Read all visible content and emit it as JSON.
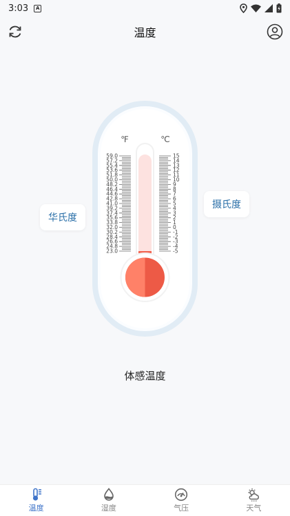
{
  "status_bar": {
    "time": "3:03",
    "notification_icon_letter": "A"
  },
  "header": {
    "title": "温度",
    "left_icon": "refresh-icon",
    "right_icon": "profile-icon"
  },
  "thermometer": {
    "fahrenheit_unit": "℉",
    "celsius_unit": "℃",
    "fahrenheit_scale": [
      "59.0",
      "57.2",
      "55.4",
      "53.6",
      "51.8",
      "50.0",
      "48.2",
      "46.4",
      "44.6",
      "42.8",
      "41.0",
      "39.2",
      "37.4",
      "35.6",
      "33.8",
      "32.0",
      "30.2",
      "28.4",
      "26.6",
      "24.8",
      "23.0"
    ],
    "celsius_scale": [
      "15",
      "14",
      "13",
      "12",
      "11",
      "10",
      "9",
      "8",
      "7",
      "6",
      "5",
      "4",
      "3",
      "2",
      "1",
      "0",
      "-1",
      "-2",
      "-3",
      "-4",
      "-5"
    ],
    "level_fraction": 0.0,
    "tube_color": "#fde2e0",
    "mercury_color": "#f2624e",
    "bulb_color_light": "#ff8168",
    "bulb_color_dark": "#ed5a46"
  },
  "unit_buttons": {
    "fahrenheit": "华氏度",
    "celsius": "摄氏度"
  },
  "feels_like_label": "体感温度",
  "bottom_nav": {
    "items": [
      {
        "label": "温度",
        "icon": "thermometer-icon",
        "active": true
      },
      {
        "label": "湿度",
        "icon": "humidity-icon",
        "active": false
      },
      {
        "label": "气压",
        "icon": "pressure-gauge-icon",
        "active": false
      },
      {
        "label": "天气",
        "icon": "weather-icon",
        "active": false
      }
    ]
  },
  "colors": {
    "accent": "#3f74c9",
    "chip_text": "#2a6fa8",
    "frame": "#e1ecf5"
  }
}
